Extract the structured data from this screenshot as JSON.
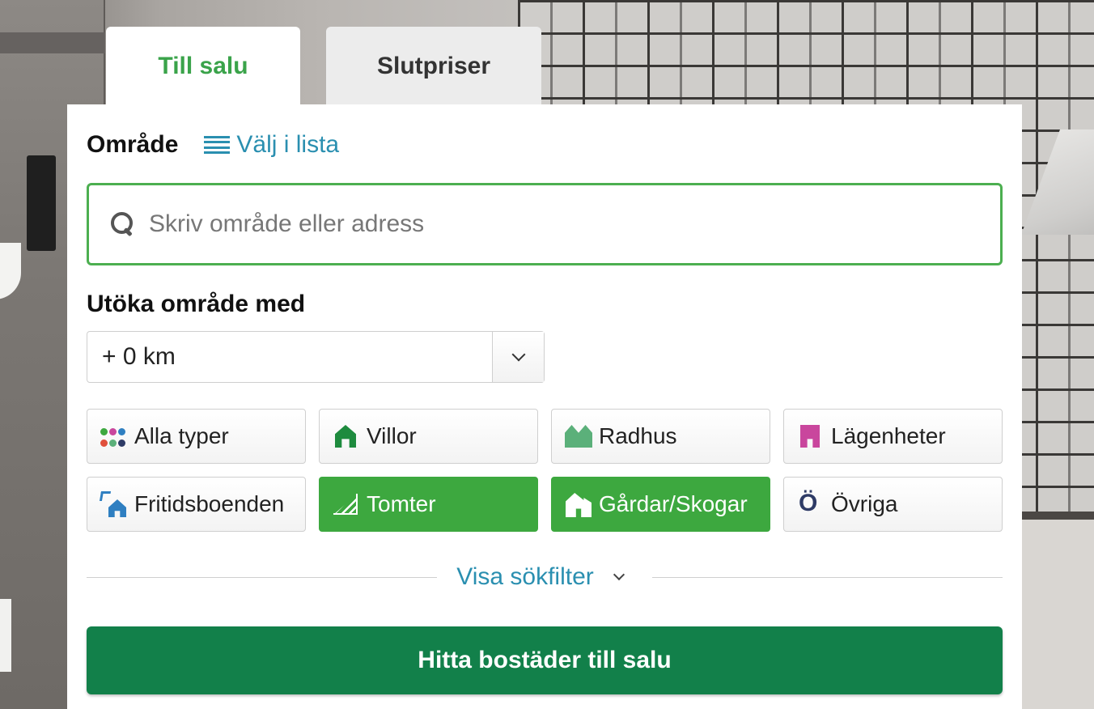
{
  "tabs": {
    "sale": "Till salu",
    "prices": "Slutpriser"
  },
  "area": {
    "label": "Område",
    "list_link": "Välj i lista"
  },
  "search": {
    "placeholder": "Skriv område eller adress",
    "value": ""
  },
  "expand": {
    "label": "Utöka område med",
    "selected": "+ 0 km"
  },
  "types": [
    {
      "label": "Alla typer",
      "icon": "all-types-dots-icon",
      "active": false
    },
    {
      "label": "Villor",
      "icon": "villa-house-icon",
      "active": false
    },
    {
      "label": "Radhus",
      "icon": "townhouse-icon",
      "active": false
    },
    {
      "label": "Lägenheter",
      "icon": "apartment-icon",
      "active": false
    },
    {
      "label": "Fritidsboenden",
      "icon": "holiday-home-icon",
      "active": false
    },
    {
      "label": "Tomter",
      "icon": "plot-icon",
      "active": true
    },
    {
      "label": "Gårdar/Skogar",
      "icon": "farm-icon",
      "active": true
    },
    {
      "label": "Övriga",
      "icon": "other-o-icon",
      "active": false
    }
  ],
  "filter": {
    "label": "Visa sökfilter"
  },
  "submit": {
    "label": "Hitta bostäder till salu"
  },
  "colors": {
    "brand_green": "#12804a",
    "active_green": "#3da83f",
    "link_blue": "#2a8fb0",
    "tab_active_text": "#3aa34a",
    "apartment_pink": "#c9469d",
    "holiday_blue": "#2f7fc1",
    "other_navy": "#2e3b66"
  }
}
